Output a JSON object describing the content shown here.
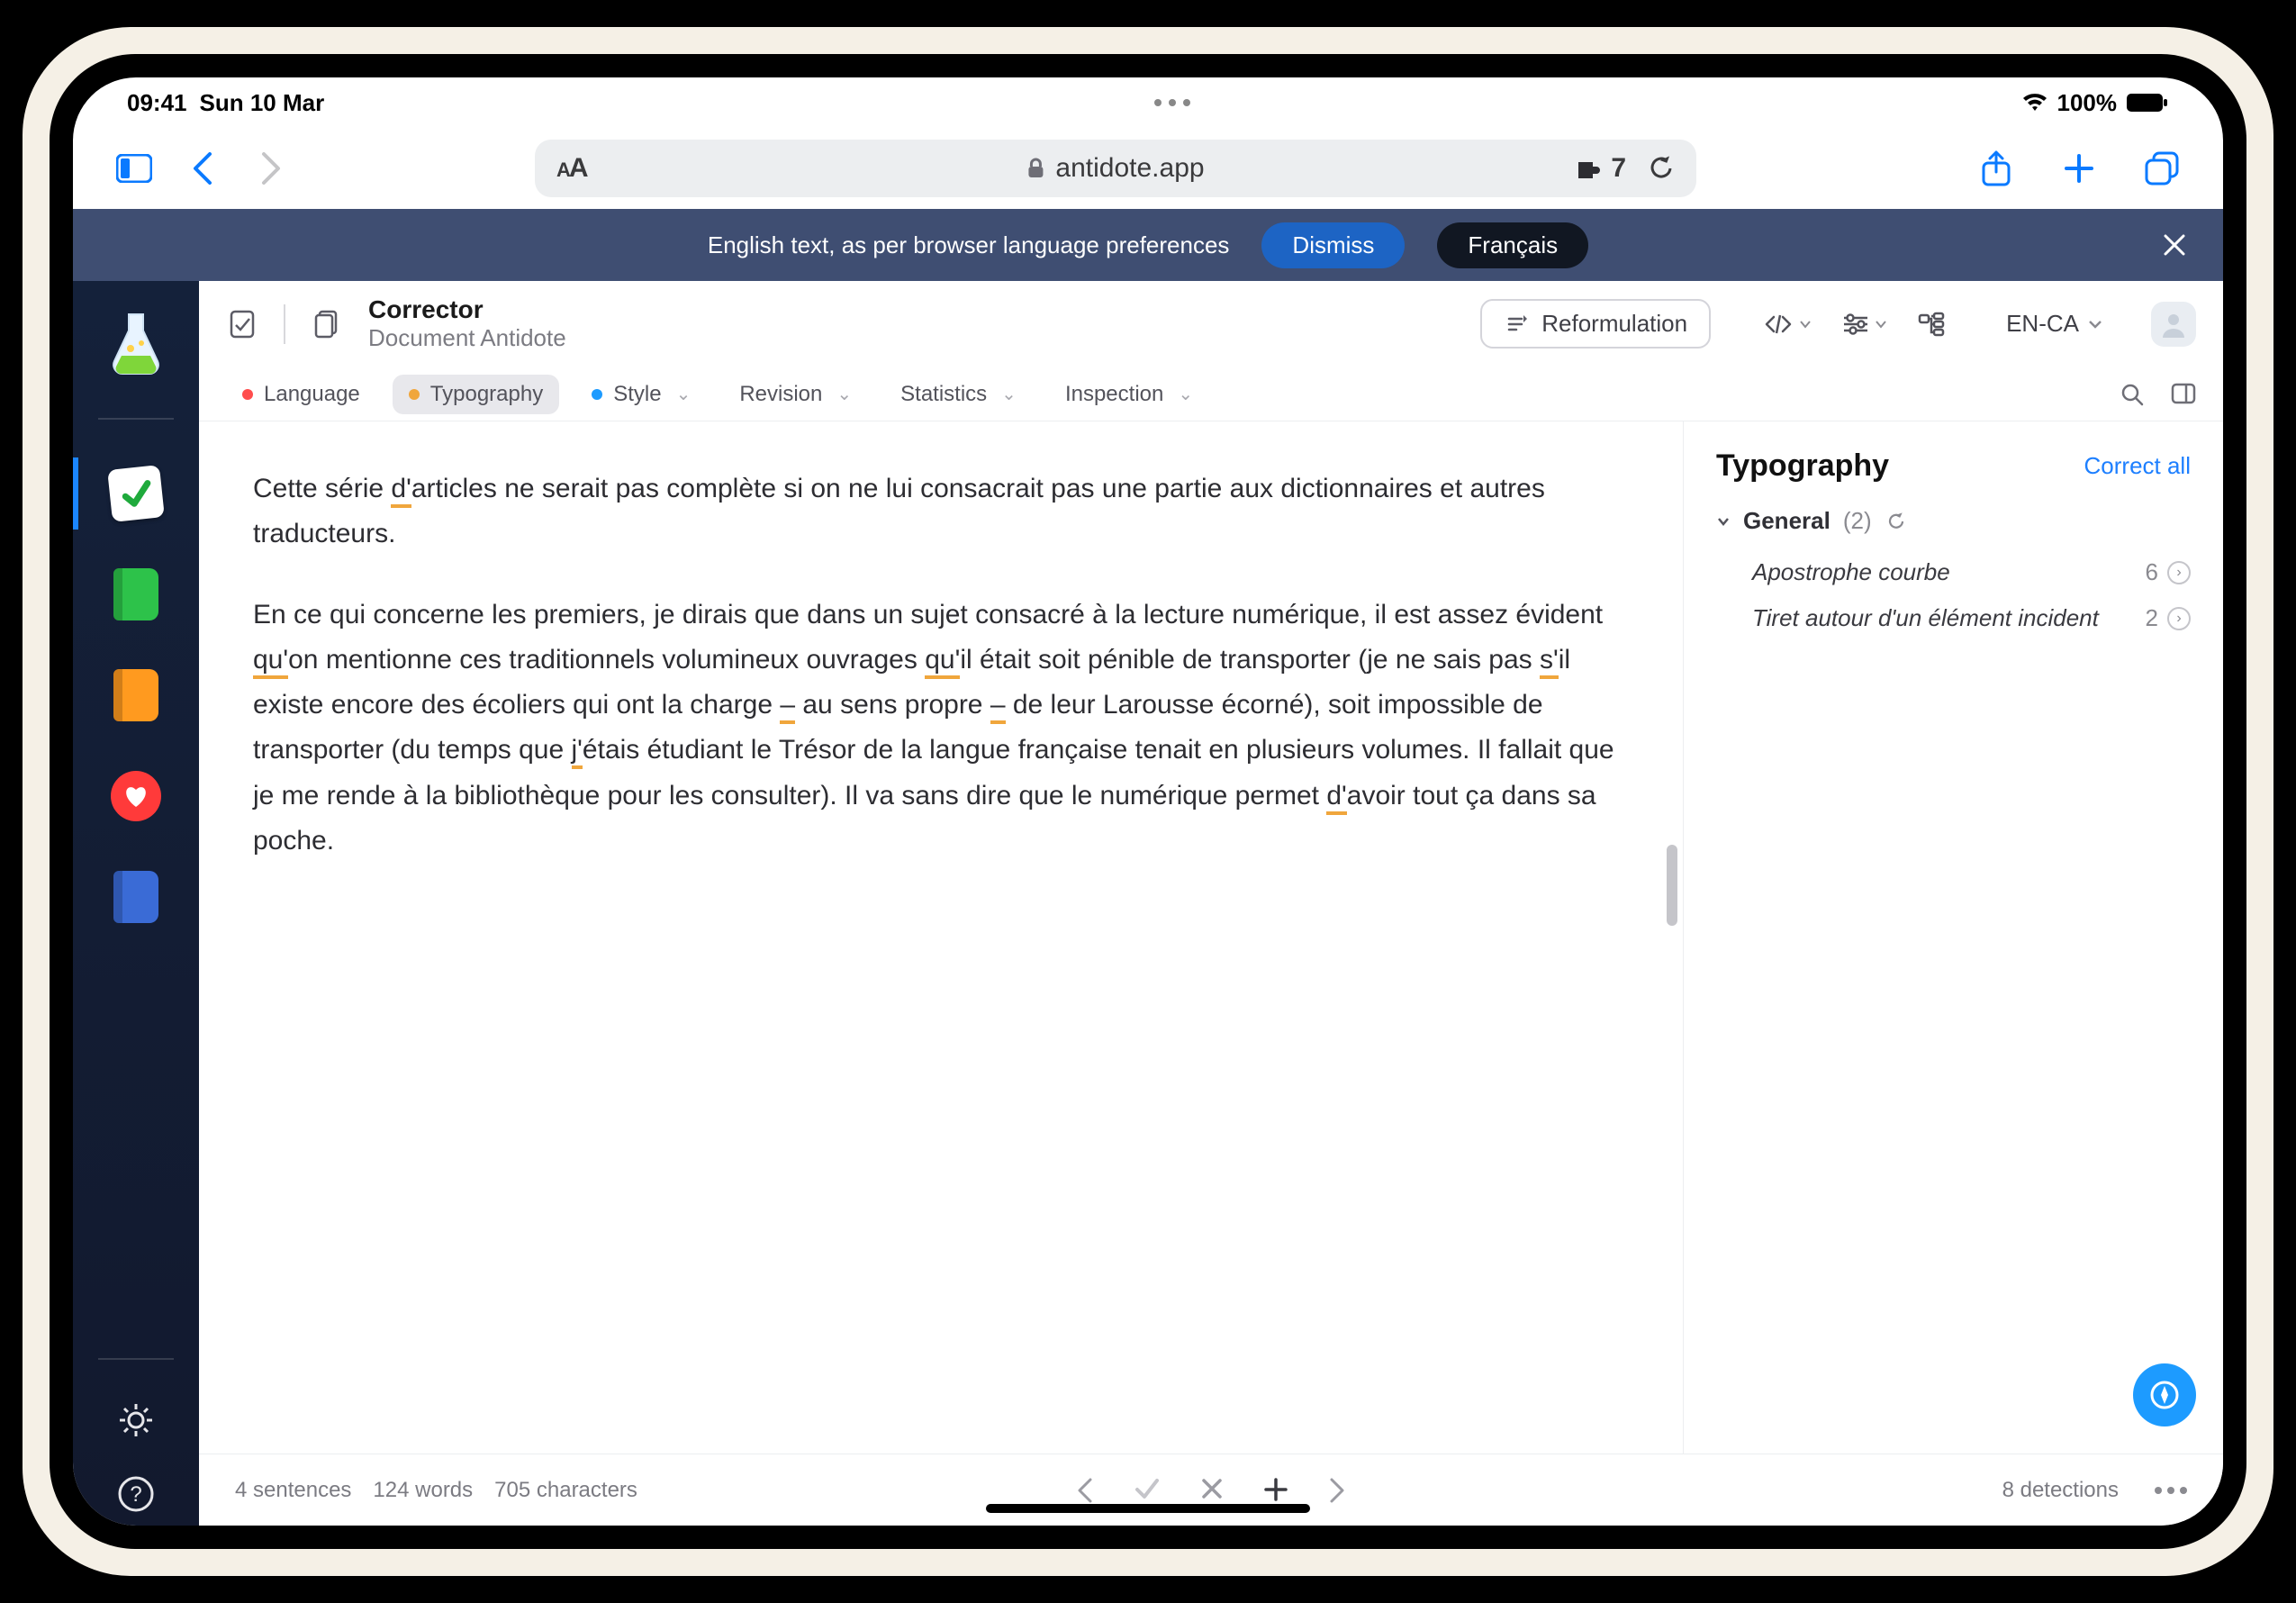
{
  "status": {
    "time": "09:41",
    "date": "Sun 10 Mar",
    "battery": "100%"
  },
  "safari": {
    "url_host": "antidote.app",
    "ext_count": "7"
  },
  "banner": {
    "text": "English text, as per browser language preferences",
    "dismiss": "Dismiss",
    "francais": "Français"
  },
  "header": {
    "title": "Corrector",
    "subtitle": "Document Antidote",
    "reformulation": "Reformulation",
    "language": "EN-CA"
  },
  "filters": {
    "language": "Language",
    "typography": "Typography",
    "style": "Style",
    "revision": "Revision",
    "statistics": "Statistics",
    "inspection": "Inspection"
  },
  "editor": {
    "p1a": "Cette série ",
    "p1u1": "d'",
    "p1b": "articles ne serait pas complète si on ne lui consacrait pas une partie aux dictionnaires et autres traducteurs.",
    "p2a": "En ce qui concerne les premiers, je dirais que dans un sujet consacré à la lecture numérique, il est assez évident ",
    "p2u1": "qu'",
    "p2b": "on mentionne ces traditionnels volumineux ouvrages ",
    "p2u2": "qu'",
    "p2c": "il était soit pénible de transporter (je ne sais pas ",
    "p2u3": "s'",
    "p2d": "il existe encore des écoliers qui ont la charge ",
    "p2u4": "–",
    "p2e": " au sens propre ",
    "p2u5": "–",
    "p2f": " de leur Larousse écorné), soit impossible de transporter (du temps que ",
    "p2u6": "j'",
    "p2g": "étais étudiant le Trésor de la langue française tenait en plusieurs volumes. Il fallait que je me rende à la bibliothèque pour les consulter). Il va sans dire que le numérique permet ",
    "p2u7": "d'",
    "p2h": "avoir tout ça dans sa poche."
  },
  "rightpane": {
    "title": "Typography",
    "correct_all": "Correct all",
    "group": "General",
    "group_count": "(2)",
    "items": [
      {
        "label": "Apostrophe courbe",
        "count": "6"
      },
      {
        "label": "Tiret autour d'un élément incident",
        "count": "2"
      }
    ]
  },
  "footer": {
    "sentences": "4 sentences",
    "words": "124 words",
    "chars": "705 characters",
    "detections": "8 detections"
  }
}
